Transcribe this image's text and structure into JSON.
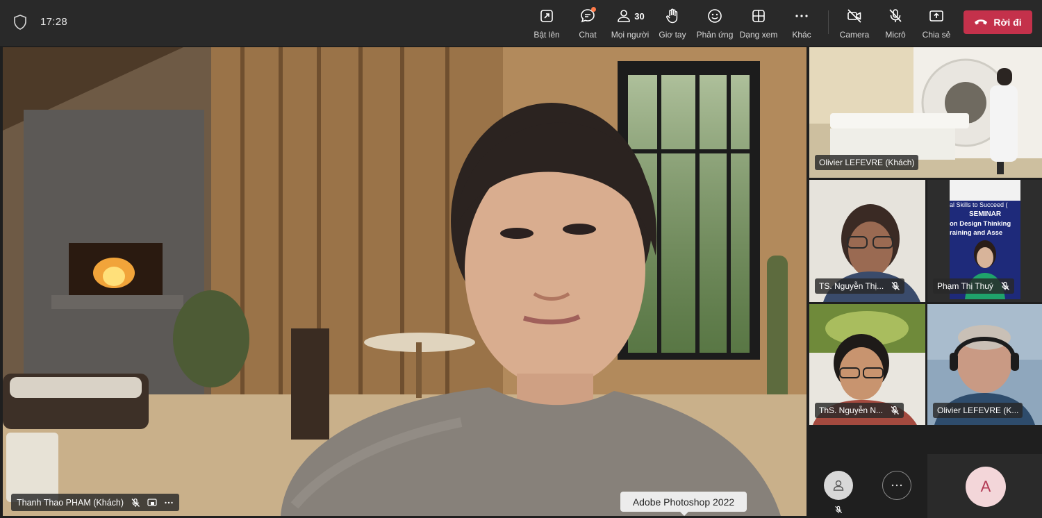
{
  "status": {
    "time": "17:28"
  },
  "toolbar": {
    "items": [
      {
        "label": "Bật lên",
        "icon": "pop-out-icon"
      },
      {
        "label": "Chat",
        "icon": "chat-icon"
      },
      {
        "label": "Mọi người",
        "icon": "people-icon",
        "count": "30"
      },
      {
        "label": "Giơ tay",
        "icon": "raise-hand-icon"
      },
      {
        "label": "Phản ứng",
        "icon": "reaction-icon"
      },
      {
        "label": "Dạng xem",
        "icon": "view-icon"
      },
      {
        "label": "Khác",
        "icon": "more-icon"
      },
      {
        "label": "Camera",
        "icon": "camera-off-icon"
      },
      {
        "label": "Micrô",
        "icon": "mic-off-icon"
      },
      {
        "label": "Chia sẻ",
        "icon": "share-icon"
      }
    ],
    "leave_label": "Rời đi",
    "leave_color": "#c4314b"
  },
  "main_video": {
    "participant": "Thanh Thao PHAM (Khách)"
  },
  "tooltip": "Adobe Photoshop 2022",
  "tiles": [
    {
      "name": "Olivier LEFEVRE (Khách)"
    },
    {
      "name": "TS. Nguyễn Thị..."
    },
    {
      "name": "Phạm Thị Thuý",
      "slide": {
        "line1": "al Skills to Succeed (",
        "line2": "SEMINAR",
        "line3": "on Design Thinking",
        "line4": "raining and Asse"
      }
    },
    {
      "name": "ThS. Nguyễn N..."
    },
    {
      "name": "Olivier LEFEVRE (K..."
    }
  ],
  "self_avatar": {
    "initial": "A"
  },
  "accent_color": "#8b8ff0"
}
